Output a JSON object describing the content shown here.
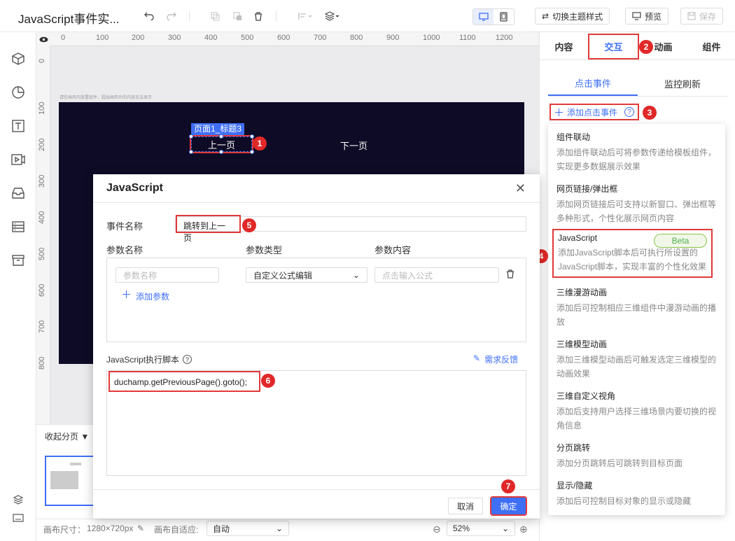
{
  "app": {
    "title": "JavaScript事件实..."
  },
  "toolbar": {
    "theme_label": "切换主题样式",
    "preview_label": "预览",
    "save_label": "保存"
  },
  "ruler": {
    "top": [
      "0",
      "100",
      "200",
      "300",
      "400",
      "500",
      "600",
      "700",
      "800",
      "900",
      "1000",
      "1100",
      "1200"
    ],
    "left": [
      "0",
      "100",
      "200",
      "300",
      "400",
      "500",
      "600",
      "700",
      "800"
    ]
  },
  "canvas": {
    "hint": "请在画布内放置组件，超出画布外的内容无法显示",
    "sel_tag": "页面1_标题3",
    "prev_label": "上一页",
    "next_label": "下一页"
  },
  "pages": {
    "collapse_label": "收起分页"
  },
  "status": {
    "size_label": "画布尺寸：",
    "size_value": "1280×720px",
    "fit_label": "画布自适应:",
    "fit_value": "自动",
    "zoom_value": "52%"
  },
  "right_panel": {
    "tabs": [
      "内容",
      "交互",
      "动画",
      "组件"
    ],
    "subtabs": [
      "点击事件",
      "监控刷新"
    ],
    "add_event_label": "添加点击事件"
  },
  "event_menu": [
    {
      "title": "组件联动",
      "desc": "添加组件联动后可将参数传递给模板组件，实现更多数据展示效果"
    },
    {
      "title": "网页链接/弹出框",
      "desc": "添加网页链接后可支持以新窗口、弹出框等多种形式，个性化展示网页内容"
    },
    {
      "title": "JavaScript",
      "desc": "添加JavaScript脚本后可执行所设置的JavaScript脚本，实现丰富的个性化效果",
      "badge": "Beta"
    },
    {
      "title": "三维漫游动画",
      "desc": "添加后可控制相应三维组件中漫游动画的播放"
    },
    {
      "title": "三维模型动画",
      "desc": "添加三维模型动画后可触发选定三维模型的动画效果"
    },
    {
      "title": "三维自定义视角",
      "desc": "添加后支持用户选择三维场景内要切换的视角信息"
    },
    {
      "title": "分页跳转",
      "desc": "添加分页跳转后可跳转到目标页面"
    },
    {
      "title": "显示/隐藏",
      "desc": "添加后可控制目标对象的显示或隐藏"
    }
  ],
  "dialog": {
    "title": "JavaScript",
    "event_name_label": "事件名称",
    "event_name_value": "跳转到上一页",
    "param_headers": [
      "参数名称",
      "参数类型",
      "参数内容"
    ],
    "param_name_placeholder": "参数名称",
    "param_type_value": "自定义公式编辑",
    "param_content_placeholder": "点击输入公式",
    "add_param_label": "添加参数",
    "script_label": "JavaScript执行脚本",
    "feedback_label": "需求反馈",
    "script_code": "duchamp.getPreviousPage().goto();",
    "cancel_label": "取消",
    "ok_label": "确定"
  },
  "badges": [
    "1",
    "2",
    "3",
    "4",
    "5",
    "6",
    "7"
  ],
  "colors": {
    "accent": "#3f6ff5",
    "highlight": "#e03a3a",
    "canvas_bg": "#0e0b26",
    "badge": "#e02828"
  }
}
